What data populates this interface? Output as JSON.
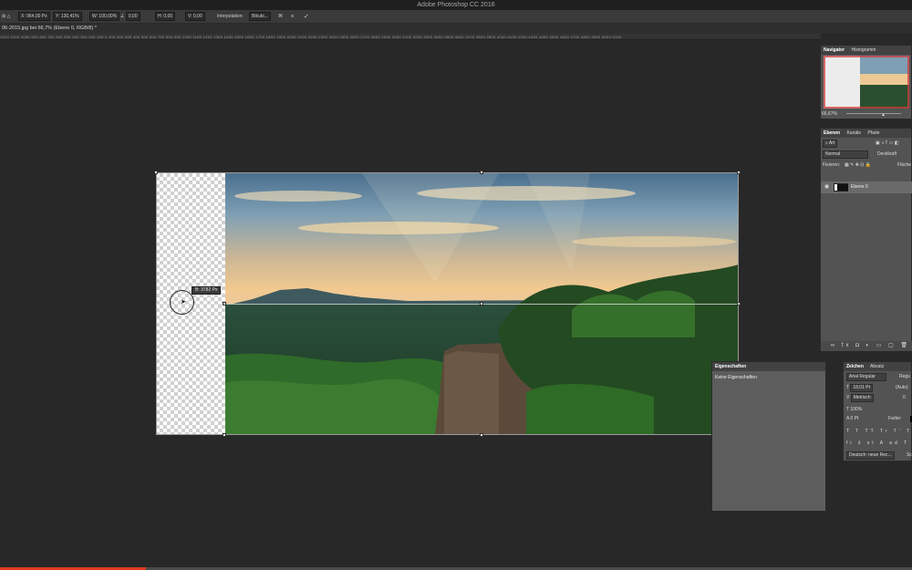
{
  "title": "Adobe Photoshop CC 2016",
  "options": {
    "x": "X: 964,00 Px",
    "y": "Y: 130,41%",
    "w": "W: 100,00%",
    "angle": "0,00",
    "h_skew": "H: 0,00",
    "v_skew": "V: 0,00",
    "interp_label": "Interpolation:",
    "interp_value": "Bikubi..."
  },
  "document_tab": "06-2015.jpg bei 66,7% (Ebene 0, RGB/8) *",
  "ruler_text": "1200 1100 1000 900 800 700 600 500 400 300 200 100 0 100 200 300 400 500 600 700 800 900 1000 1100 1200 1300 1400 1500 1600 1700 1800 1900 2000 2100 2200 2300 2400 2500 2600 2700 2800 2900 3000 3100 3200 3300 3400 3500 3600 3700 3800 3900 4000 4100 4200 4300 4400 4500 4600 4700 4800 4900 5000 5100",
  "tooltip": "B: 3782 Px",
  "navigator": {
    "tabs": [
      "Navigator",
      "Histogramm"
    ],
    "zoom": "66,67%"
  },
  "layers": {
    "tabs": [
      "Ebenen",
      "Kanäle",
      "Pfade"
    ],
    "kind": "Art",
    "blend_mode": "Normal",
    "opacity_label": "Deckkraft",
    "fix_label": "Fixieren:",
    "fill_label": "Fläche",
    "layer_name": "Ebene 0",
    "footer_icons": "∞ fx ◘ ◐ ▭ ▢ 🗑"
  },
  "properties": {
    "title": "Eigenschaften",
    "body": "Keine Eigenschaften"
  },
  "character": {
    "tabs": [
      "Zeichen",
      "Absatz"
    ],
    "font": "Arial Regular",
    "font_style": "Regu",
    "size": "18,01 Pt",
    "leading": "(Auto)",
    "kerning": "Metrisch",
    "tracking": "0",
    "scale": "100%",
    "baseline": "0 Pt",
    "color_label": "Farbe:",
    "language": "Deutsch: neue Rec...",
    "aa": "Sc"
  },
  "progress": 0.16
}
